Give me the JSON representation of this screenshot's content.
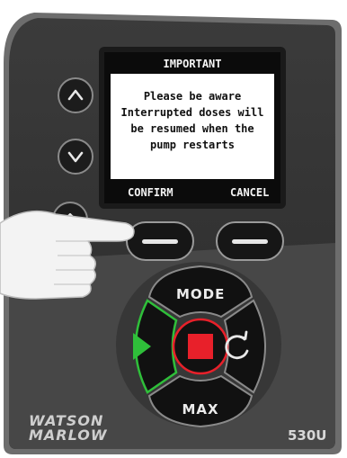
{
  "screen": {
    "title": "IMPORTANT",
    "message_lines": [
      "Please be aware",
      "Interrupted doses will",
      "be resumed when the",
      "pump restarts"
    ],
    "left_softkey": "CONFIRM",
    "right_softkey": "CANCEL"
  },
  "keypad": {
    "mode_label": "MODE",
    "max_label": "MAX"
  },
  "branding": {
    "brand_line1": "WATSON",
    "brand_line2": "MARLOW",
    "model": "530U"
  },
  "colors": {
    "panel_dark": "#2f2f2f",
    "panel_lower": "#4a4a4a",
    "start_green": "#2fbf3a",
    "stop_red": "#e8202a"
  }
}
